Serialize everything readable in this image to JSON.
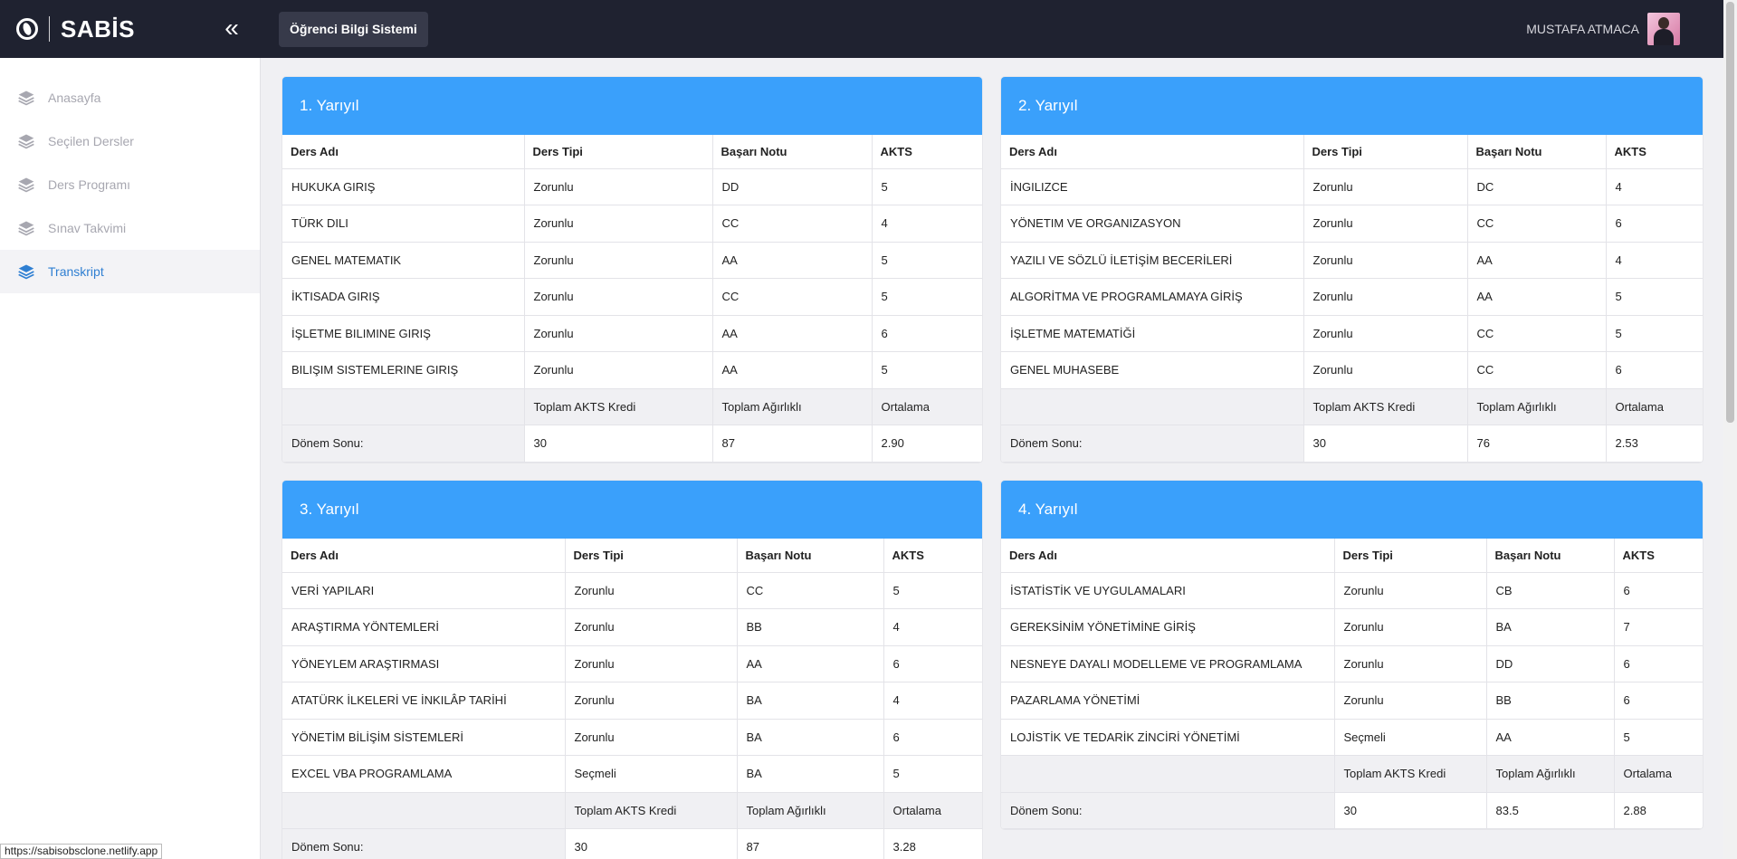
{
  "header": {
    "logo_text": "SABİS",
    "app_name": "Öğrenci Bilgi Sistemi",
    "user_name": "MUSTAFA ATMACA"
  },
  "sidebar": {
    "items": [
      {
        "label": "Anasayfa",
        "active": false
      },
      {
        "label": "Seçilen Dersler",
        "active": false
      },
      {
        "label": "Ders Programı",
        "active": false
      },
      {
        "label": "Sınav Takvimi",
        "active": false
      },
      {
        "label": "Transkript",
        "active": true
      }
    ]
  },
  "columns": {
    "name": "Ders Adı",
    "type": "Ders Tipi",
    "grade": "Başarı Notu",
    "ects": "AKTS"
  },
  "summary_labels": {
    "total_ects": "Toplam AKTS Kredi",
    "total_weighted": "Toplam Ağırlıklı",
    "average": "Ortalama",
    "term_end": "Dönem Sonu:"
  },
  "semesters": [
    {
      "title": "1. Yarıyıl",
      "courses": [
        [
          "HUKUKA GIRIŞ",
          "Zorunlu",
          "DD",
          "5"
        ],
        [
          "TÜRK DILI",
          "Zorunlu",
          "CC",
          "4"
        ],
        [
          "GENEL MATEMATIK",
          "Zorunlu",
          "AA",
          "5"
        ],
        [
          "İKTISADA GIRIŞ",
          "Zorunlu",
          "CC",
          "5"
        ],
        [
          "İŞLETME BILIMINE GIRIŞ",
          "Zorunlu",
          "AA",
          "6"
        ],
        [
          "BILIŞIM SISTEMLERINE GIRIŞ",
          "Zorunlu",
          "AA",
          "5"
        ]
      ],
      "total_ects": "30",
      "total_weighted": "87",
      "average": "2.90"
    },
    {
      "title": "2. Yarıyıl",
      "courses": [
        [
          "İNGILIZCE",
          "Zorunlu",
          "DC",
          "4"
        ],
        [
          "YÖNETIM VE ORGANIZASYON",
          "Zorunlu",
          "CC",
          "6"
        ],
        [
          "YAZILI VE SÖZLÜ İLETİŞİM BECERİLERİ",
          "Zorunlu",
          "AA",
          "4"
        ],
        [
          "ALGORİTMA VE PROGRAMLAMAYA GİRİŞ",
          "Zorunlu",
          "AA",
          "5"
        ],
        [
          "İŞLETME MATEMATİĞİ",
          "Zorunlu",
          "CC",
          "5"
        ],
        [
          "GENEL MUHASEBE",
          "Zorunlu",
          "CC",
          "6"
        ]
      ],
      "total_ects": "30",
      "total_weighted": "76",
      "average": "2.53"
    },
    {
      "title": "3. Yarıyıl",
      "courses": [
        [
          "VERİ YAPILARI",
          "Zorunlu",
          "CC",
          "5"
        ],
        [
          "ARAŞTIRMA YÖNTEMLERİ",
          "Zorunlu",
          "BB",
          "4"
        ],
        [
          "YÖNEYLEM ARAŞTIRMASI",
          "Zorunlu",
          "AA",
          "6"
        ],
        [
          "ATATÜRK İLKELERİ VE İNKILÂP TARİHİ",
          "Zorunlu",
          "BA",
          "4"
        ],
        [
          "YÖNETİM BİLİŞİM SİSTEMLERİ",
          "Zorunlu",
          "BA",
          "6"
        ],
        [
          "EXCEL VBA PROGRAMLAMA",
          "Seçmeli",
          "BA",
          "5"
        ]
      ],
      "total_ects": "30",
      "total_weighted": "87",
      "average": "3.28"
    },
    {
      "title": "4. Yarıyıl",
      "courses": [
        [
          "İSTATİSTİK VE UYGULAMALARI",
          "Zorunlu",
          "CB",
          "6"
        ],
        [
          "GEREKSİNİM YÖNETİMİNE GİRİŞ",
          "Zorunlu",
          "BA",
          "7"
        ],
        [
          "NESNEYE DAYALI MODELLEME VE PROGRAMLAMA",
          "Zorunlu",
          "DD",
          "6"
        ],
        [
          "PAZARLAMA YÖNETİMİ",
          "Zorunlu",
          "BB",
          "6"
        ],
        [
          "LOJİSTİK VE TEDARİK ZİNCİRİ YÖNETİMİ",
          "Seçmeli",
          "AA",
          "5"
        ]
      ],
      "total_ects": "30",
      "total_weighted": "83.5",
      "average": "2.88"
    }
  ],
  "status_url": "https://sabisobsclone.netlify.app",
  "colors": {
    "accent": "#3aa0fb",
    "topbar": "#1f2230",
    "active_nav": "#2f7fd2"
  }
}
